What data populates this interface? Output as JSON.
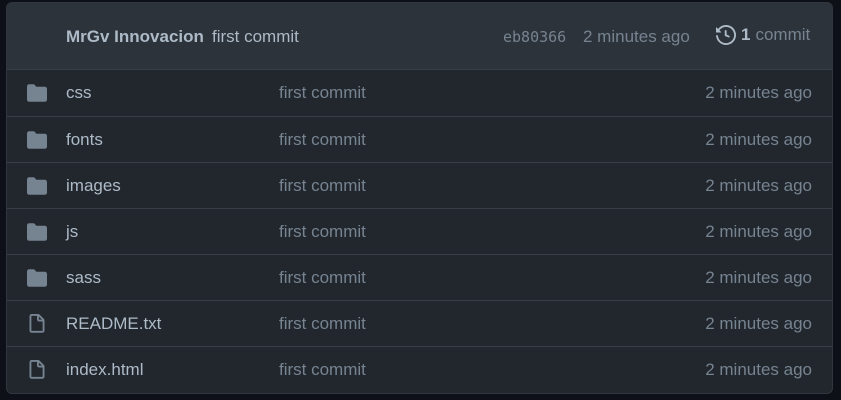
{
  "latest_commit": {
    "author": "MrGv Innovacion",
    "message": "first commit",
    "sha": "eb80366",
    "age": "2 minutes ago",
    "history_count": "1",
    "history_word": "commit",
    "history_icon": "history-icon"
  },
  "files": [
    {
      "name": "css",
      "type": "folder",
      "icon": "folder-icon",
      "message": "first commit",
      "age": "2 minutes ago"
    },
    {
      "name": "fonts",
      "type": "folder",
      "icon": "folder-icon",
      "message": "first commit",
      "age": "2 minutes ago"
    },
    {
      "name": "images",
      "type": "folder",
      "icon": "folder-icon",
      "message": "first commit",
      "age": "2 minutes ago"
    },
    {
      "name": "js",
      "type": "folder",
      "icon": "folder-icon",
      "message": "first commit",
      "age": "2 minutes ago"
    },
    {
      "name": "sass",
      "type": "folder",
      "icon": "folder-icon",
      "message": "first commit",
      "age": "2 minutes ago"
    },
    {
      "name": "README.txt",
      "type": "file",
      "icon": "file-icon",
      "message": "first commit",
      "age": "2 minutes ago"
    },
    {
      "name": "index.html",
      "type": "file",
      "icon": "file-icon",
      "message": "first commit",
      "age": "2 minutes ago"
    }
  ],
  "colors": {
    "background": "#0d1117",
    "panel": "#22272e",
    "header": "#2d333b",
    "border": "#373e47",
    "text": "#adbac7",
    "muted": "#768390",
    "folder_icon": "#768390"
  }
}
